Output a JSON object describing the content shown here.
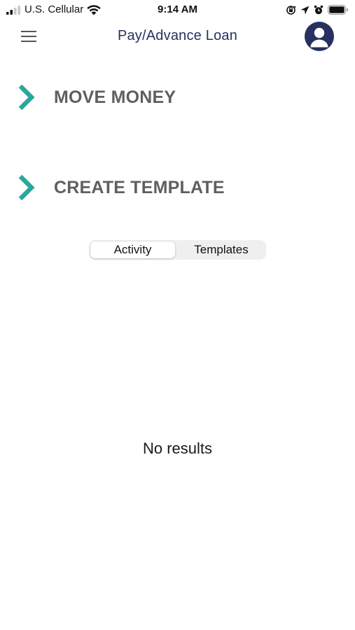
{
  "status_bar": {
    "carrier": "U.S. Cellular",
    "time": "9:14 AM",
    "icons": [
      "signal-icon",
      "wifi-icon",
      "orientation-lock-icon",
      "location-icon",
      "alarm-icon",
      "battery-icon"
    ]
  },
  "header": {
    "title": "Pay/Advance Loan",
    "menu_icon": "hamburger-menu-icon",
    "profile_icon": "user-profile-icon"
  },
  "actions": [
    {
      "label": "MOVE MONEY",
      "icon": "chevron-right-icon"
    },
    {
      "label": "CREATE TEMPLATE",
      "icon": "chevron-right-icon"
    }
  ],
  "tabs": {
    "selected": "Activity",
    "items": [
      {
        "label": "Activity"
      },
      {
        "label": "Templates"
      }
    ]
  },
  "main": {
    "empty_text": "No results"
  },
  "colors": {
    "accent_teal": "#2aa79b",
    "navy": "#27305e",
    "action_text": "#5f5f5f",
    "segment_bg": "#efefef"
  }
}
